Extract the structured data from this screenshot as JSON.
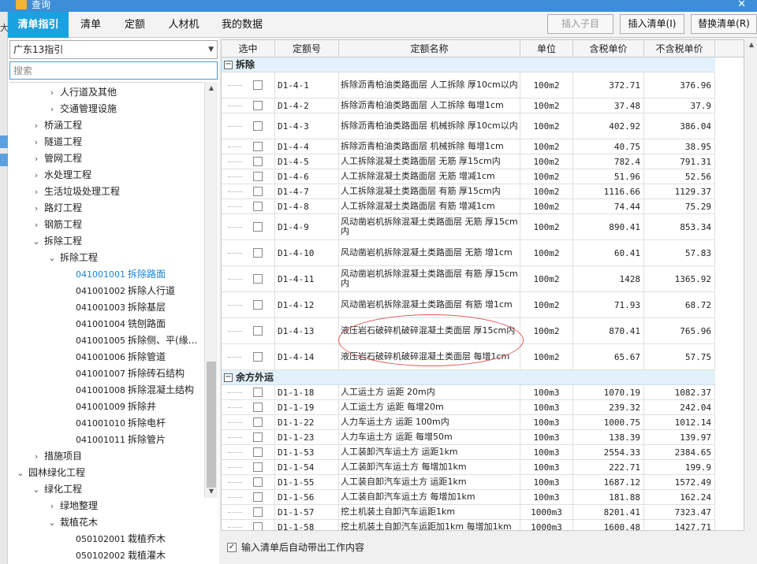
{
  "window": {
    "title": "查询"
  },
  "edge_char": "大",
  "tabs": [
    "清单指引",
    "清单",
    "定额",
    "人材机",
    "我的数据"
  ],
  "toolbar": {
    "insert_child": "插入子目",
    "insert_list": "插入清单(I)",
    "replace_list": "替换清单(R)"
  },
  "left": {
    "guide_select": "广东13指引",
    "search_placeholder": "搜索",
    "tree": [
      {
        "indent": 2,
        "arrow": "›",
        "code": "",
        "label": "人行道及其他"
      },
      {
        "indent": 2,
        "arrow": "›",
        "code": "",
        "label": "交通管理设施"
      },
      {
        "indent": 1,
        "arrow": "›",
        "code": "",
        "label": "桥涵工程"
      },
      {
        "indent": 1,
        "arrow": "›",
        "code": "",
        "label": "隧道工程"
      },
      {
        "indent": 1,
        "arrow": "›",
        "code": "",
        "label": "管网工程"
      },
      {
        "indent": 1,
        "arrow": "›",
        "code": "",
        "label": "水处理工程"
      },
      {
        "indent": 1,
        "arrow": "›",
        "code": "",
        "label": "生活垃圾处理工程"
      },
      {
        "indent": 1,
        "arrow": "›",
        "code": "",
        "label": "路灯工程"
      },
      {
        "indent": 1,
        "arrow": "›",
        "code": "",
        "label": "钢筋工程"
      },
      {
        "indent": 1,
        "arrow": "⌄",
        "code": "",
        "label": "拆除工程"
      },
      {
        "indent": 2,
        "arrow": "⌄",
        "code": "",
        "label": "拆除工程"
      },
      {
        "indent": 3,
        "arrow": "",
        "code": "041001001",
        "label": "拆除路面",
        "selected": true
      },
      {
        "indent": 3,
        "arrow": "",
        "code": "041001002",
        "label": "拆除人行道"
      },
      {
        "indent": 3,
        "arrow": "",
        "code": "041001003",
        "label": "拆除基层"
      },
      {
        "indent": 3,
        "arrow": "",
        "code": "041001004",
        "label": "铣刨路面"
      },
      {
        "indent": 3,
        "arrow": "",
        "code": "041001005",
        "label": "拆除侧、平(缘…"
      },
      {
        "indent": 3,
        "arrow": "",
        "code": "041001006",
        "label": "拆除管道"
      },
      {
        "indent": 3,
        "arrow": "",
        "code": "041001007",
        "label": "拆除砖石结构"
      },
      {
        "indent": 3,
        "arrow": "",
        "code": "041001008",
        "label": "拆除混凝土结构"
      },
      {
        "indent": 3,
        "arrow": "",
        "code": "041001009",
        "label": "拆除井"
      },
      {
        "indent": 3,
        "arrow": "",
        "code": "041001010",
        "label": "拆除电杆"
      },
      {
        "indent": 3,
        "arrow": "",
        "code": "041001011",
        "label": "拆除管片"
      },
      {
        "indent": 1,
        "arrow": "›",
        "code": "",
        "label": "措施项目"
      },
      {
        "indent": 0,
        "arrow": "⌄",
        "code": "",
        "label": "园林绿化工程"
      },
      {
        "indent": 1,
        "arrow": "⌄",
        "code": "",
        "label": "绿化工程"
      },
      {
        "indent": 2,
        "arrow": "›",
        "code": "",
        "label": "绿地整理"
      },
      {
        "indent": 2,
        "arrow": "⌄",
        "code": "",
        "label": "栽植花木"
      },
      {
        "indent": 3,
        "arrow": "",
        "code": "050102001",
        "label": "栽植乔木"
      },
      {
        "indent": 3,
        "arrow": "",
        "code": "050102002",
        "label": "栽植灌木"
      }
    ]
  },
  "grid": {
    "columns": [
      "选中",
      "定额号",
      "定额名称",
      "单位",
      "含税单价",
      "不含税单价"
    ],
    "groups": [
      {
        "label": "拆除",
        "rows": [
          {
            "code": "D1-4-1",
            "name": "拆除沥青柏油类路面层 人工拆除 厚10cm以内",
            "unit": "100m2",
            "tax": "372.71",
            "notax": "376.96",
            "h": 2
          },
          {
            "code": "D1-4-2",
            "name": "拆除沥青柏油类路面层 人工拆除 每增1cm",
            "unit": "100m2",
            "tax": "37.48",
            "notax": "37.9",
            "h": 1
          },
          {
            "code": "D1-4-3",
            "name": "拆除沥青柏油类路面层 机械拆除 厚10cm以内",
            "unit": "100m2",
            "tax": "402.92",
            "notax": "386.04",
            "h": 2
          },
          {
            "code": "D1-4-4",
            "name": "拆除沥青柏油类路面层 机械拆除 每增1cm",
            "unit": "100m2",
            "tax": "40.75",
            "notax": "38.95",
            "h": 1
          },
          {
            "code": "D1-4-5",
            "name": "人工拆除混凝土类路面层 无筋 厚15cm内",
            "unit": "100m2",
            "tax": "782.4",
            "notax": "791.31",
            "h": 1
          },
          {
            "code": "D1-4-6",
            "name": "人工拆除混凝土类路面层 无筋 增减1cm",
            "unit": "100m2",
            "tax": "51.96",
            "notax": "52.56",
            "h": 1
          },
          {
            "code": "D1-4-7",
            "name": "人工拆除混凝土类路面层 有筋 厚15cm内",
            "unit": "100m2",
            "tax": "1116.66",
            "notax": "1129.37",
            "h": 1
          },
          {
            "code": "D1-4-8",
            "name": "人工拆除混凝土类路面层 有筋 增减1cm",
            "unit": "100m2",
            "tax": "74.44",
            "notax": "75.29",
            "h": 1
          },
          {
            "code": "D1-4-9",
            "name": "风动凿岩机拆除混凝土类路面层 无筋 厚15cm内",
            "unit": "100m2",
            "tax": "890.41",
            "notax": "853.34",
            "h": 2
          },
          {
            "code": "D1-4-10",
            "name": "风动凿岩机拆除混凝土类路面层 无筋 增1cm",
            "unit": "100m2",
            "tax": "60.41",
            "notax": "57.83",
            "h": 2
          },
          {
            "code": "D1-4-11",
            "name": "风动凿岩机拆除混凝土类路面层 有筋 厚15cm内",
            "unit": "100m2",
            "tax": "1428",
            "notax": "1365.92",
            "h": 2
          },
          {
            "code": "D1-4-12",
            "name": "风动凿岩机拆除混凝土类路面层 有筋 增1cm",
            "unit": "100m2",
            "tax": "71.93",
            "notax": "68.72",
            "h": 2
          },
          {
            "code": "D1-4-13",
            "name": "液压岩石破碎机破碎混凝土类面层 厚15cm内",
            "unit": "100m2",
            "tax": "870.41",
            "notax": "765.96",
            "h": 2
          },
          {
            "code": "D1-4-14",
            "name": "液压岩石破碎机破碎混凝土类面层 每增1cm",
            "unit": "100m2",
            "tax": "65.67",
            "notax": "57.75",
            "h": 2
          }
        ]
      },
      {
        "label": "余方外运",
        "rows": [
          {
            "code": "D1-1-18",
            "name": "人工运土方 运距 20m内",
            "unit": "100m3",
            "tax": "1070.19",
            "notax": "1082.37",
            "h": 1
          },
          {
            "code": "D1-1-19",
            "name": "人工运土方 运距 每增20m",
            "unit": "100m3",
            "tax": "239.32",
            "notax": "242.04",
            "h": 1
          },
          {
            "code": "D1-1-22",
            "name": "人力车运土方 运距 100m内",
            "unit": "100m3",
            "tax": "1000.75",
            "notax": "1012.14",
            "h": 1
          },
          {
            "code": "D1-1-23",
            "name": "人力车运土方 运距 每增50m",
            "unit": "100m3",
            "tax": "138.39",
            "notax": "139.97",
            "h": 1
          },
          {
            "code": "D1-1-53",
            "name": "人工装卸汽车运土方 运距1km",
            "unit": "100m3",
            "tax": "2554.33",
            "notax": "2384.65",
            "h": 1
          },
          {
            "code": "D1-1-54",
            "name": "人工装卸汽车运土方 每增加1km",
            "unit": "100m3",
            "tax": "222.71",
            "notax": "199.9",
            "h": 1
          },
          {
            "code": "D1-1-55",
            "name": "人工装自卸汽车运土方 运距1km",
            "unit": "100m3",
            "tax": "1687.12",
            "notax": "1572.49",
            "h": 1
          },
          {
            "code": "D1-1-56",
            "name": "人工装自卸汽车运土方 每增加1km",
            "unit": "100m3",
            "tax": "181.88",
            "notax": "162.24",
            "h": 1
          },
          {
            "code": "D1-1-57",
            "name": "挖土机装土自卸汽车运距1km",
            "unit": "1000m3",
            "tax": "8201.41",
            "notax": "7323.47",
            "h": 1
          },
          {
            "code": "D1-1-58",
            "name": "挖土机装土自卸汽车运距加1km 每增加1km",
            "unit": "1000m3",
            "tax": "1600.48",
            "notax": "1427.71",
            "h": 1
          }
        ]
      }
    ]
  },
  "footer": {
    "auto_bring_label": "输入清单后自动带出工作内容",
    "checked": true
  }
}
